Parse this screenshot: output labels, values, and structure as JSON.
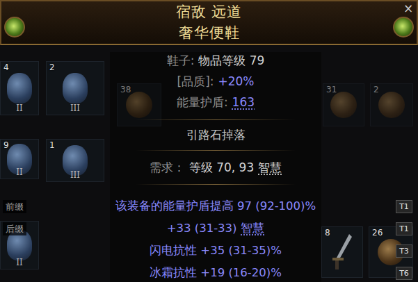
{
  "header": {
    "name": "宿敌 远道",
    "base": "奢华便鞋",
    "close": "×"
  },
  "properties": [
    {
      "segments": [
        {
          "text": "鞋子:",
          "kind": "label",
          "underline": false
        },
        {
          "text": "物品等级 79",
          "kind": "plain",
          "underline": false
        }
      ]
    },
    {
      "segments": [
        {
          "text": "[品质]:",
          "kind": "label",
          "underline": false
        },
        {
          "text": "+20%",
          "kind": "value",
          "underline": false
        }
      ]
    },
    {
      "segments": [
        {
          "text": "能量护盾:",
          "kind": "label",
          "underline": false
        },
        {
          "text": "163",
          "kind": "value",
          "underline": true
        }
      ]
    }
  ],
  "flags": [
    "引路石掉落"
  ],
  "requirements": {
    "segments": [
      {
        "text": "需求：",
        "kind": "label",
        "underline": false
      },
      {
        "text": "等级 70, 93",
        "kind": "plain",
        "underline": false
      },
      {
        "text": "智慧",
        "kind": "plain",
        "underline": true
      }
    ]
  },
  "mods": [
    {
      "group": "前缀",
      "segments": [
        {
          "text": "该装备的能量护盾提高 97 (92-100)%",
          "underline": false
        }
      ],
      "tier": "T1"
    },
    {
      "group": "后缀",
      "segments": [
        {
          "text": "+33 (31-33)",
          "underline": false
        },
        {
          "text": "智慧",
          "underline": true
        }
      ],
      "tier": "T1"
    },
    {
      "segments": [
        {
          "text": "闪电抗性 +35 (31-35)%",
          "underline": false
        }
      ],
      "tier": "T3"
    },
    {
      "segments": [
        {
          "text": "冰霜抗性 +19 (16-20)%",
          "underline": false
        }
      ],
      "tier": "T6"
    }
  ],
  "inventory": {
    "slots": [
      {
        "kind": "mask",
        "count": "4",
        "tier": "II",
        "dimmed": false
      },
      {
        "kind": "mask",
        "count": "2",
        "tier": "III",
        "dimmed": false
      },
      {
        "kind": "orb",
        "count": "38",
        "dimmed": true
      },
      {
        "kind": "orb",
        "count": "31",
        "dimmed": true
      },
      {
        "kind": "orb",
        "count": "2",
        "dimmed": true
      },
      {
        "kind": "mask",
        "count": "9",
        "tier": "II",
        "dimmed": false
      },
      {
        "kind": "mask",
        "count": "1",
        "tier": "III",
        "dimmed": false
      },
      {
        "kind": "mask",
        "tier": "II",
        "dimmed": false
      },
      {
        "kind": "dagger",
        "count": "8",
        "dimmed": false
      },
      {
        "kind": "orb",
        "count": "26",
        "dimmed": false
      }
    ]
  }
}
